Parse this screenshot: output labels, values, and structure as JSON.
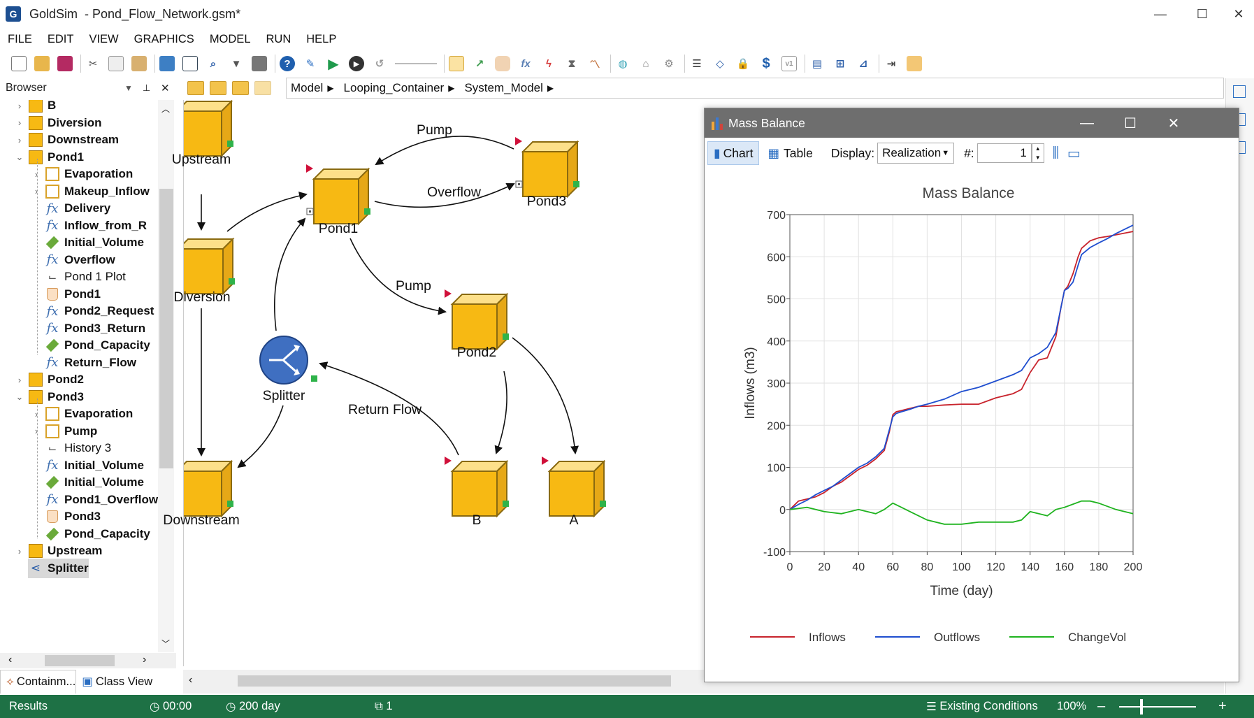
{
  "app": {
    "name": "GoldSim",
    "file": "Pond_Flow_Network.gsm*"
  },
  "window": {
    "min": "—",
    "max": "☐",
    "close": "✕"
  },
  "menu": [
    "FILE",
    "EDIT",
    "VIEW",
    "GRAPHICS",
    "MODEL",
    "RUN",
    "HELP"
  ],
  "browser": {
    "title": "Browser",
    "pin": "📌",
    "close": "✕"
  },
  "breadcrumb": [
    "Model",
    "Looping_Container",
    "System_Model"
  ],
  "tree": [
    {
      "label": "B",
      "icon": "container-icon",
      "bold": true,
      "level": 0,
      "tw": "›"
    },
    {
      "label": "Diversion",
      "icon": "container-icon",
      "bold": true,
      "level": 0,
      "tw": "›"
    },
    {
      "label": "Downstream",
      "icon": "container-icon",
      "bold": true,
      "level": 0,
      "tw": "›"
    },
    {
      "label": "Pond1",
      "icon": "container-icon",
      "bold": true,
      "level": 0,
      "tw": "⌄"
    },
    {
      "label": "Evaporation",
      "icon": "subcontainer-icon",
      "bold": true,
      "level": 1,
      "tw": "›"
    },
    {
      "label": "Makeup_Inflow",
      "icon": "subcontainer-icon",
      "bold": true,
      "level": 1,
      "tw": "›"
    },
    {
      "label": "Delivery",
      "icon": "expression-icon",
      "bold": true,
      "level": 1,
      "tw": ""
    },
    {
      "label": "Inflow_from_R",
      "icon": "expression-icon",
      "bold": true,
      "level": 1,
      "tw": ""
    },
    {
      "label": "Initial_Volume",
      "icon": "data-icon",
      "bold": true,
      "level": 1,
      "tw": ""
    },
    {
      "label": "Overflow",
      "icon": "expression-icon",
      "bold": true,
      "level": 1,
      "tw": ""
    },
    {
      "label": "Pond 1 Plot",
      "icon": "plot-icon",
      "bold": false,
      "level": 1,
      "tw": ""
    },
    {
      "label": "Pond1",
      "icon": "reservoir-icon",
      "bold": true,
      "level": 1,
      "tw": ""
    },
    {
      "label": "Pond2_Request",
      "icon": "expression-icon",
      "bold": true,
      "level": 1,
      "tw": ""
    },
    {
      "label": "Pond3_Return",
      "icon": "expression-icon",
      "bold": true,
      "level": 1,
      "tw": ""
    },
    {
      "label": "Pond_Capacity",
      "icon": "data-icon",
      "bold": true,
      "level": 1,
      "tw": ""
    },
    {
      "label": "Return_Flow",
      "icon": "expression-icon",
      "bold": true,
      "level": 1,
      "tw": ""
    },
    {
      "label": "Pond2",
      "icon": "container-icon",
      "bold": true,
      "level": 0,
      "tw": "›"
    },
    {
      "label": "Pond3",
      "icon": "container-icon",
      "bold": true,
      "level": 0,
      "tw": "⌄"
    },
    {
      "label": "Evaporation",
      "icon": "subcontainer-icon",
      "bold": true,
      "level": 1,
      "tw": "›"
    },
    {
      "label": "Pump",
      "icon": "subcontainer-icon",
      "bold": true,
      "level": 1,
      "tw": "›"
    },
    {
      "label": "History 3",
      "icon": "plot-icon",
      "bold": false,
      "level": 1,
      "tw": ""
    },
    {
      "label": "Initial_Volume",
      "icon": "expression-icon",
      "bold": true,
      "level": 1,
      "tw": ""
    },
    {
      "label": "Initial_Volume",
      "icon": "data-icon",
      "bold": true,
      "level": 1,
      "tw": ""
    },
    {
      "label": "Pond1_Overflow",
      "icon": "expression-icon",
      "bold": true,
      "level": 1,
      "tw": ""
    },
    {
      "label": "Pond3",
      "icon": "reservoir-icon",
      "bold": true,
      "level": 1,
      "tw": ""
    },
    {
      "label": "Pond_Capacity",
      "icon": "data-icon",
      "bold": true,
      "level": 1,
      "tw": ""
    },
    {
      "label": "Upstream",
      "icon": "container-icon",
      "bold": true,
      "level": 0,
      "tw": "›"
    },
    {
      "label": "Splitter",
      "icon": "splitter-icon",
      "bold": true,
      "level": 0,
      "tw": "",
      "selected": true
    }
  ],
  "bottom_tabs": {
    "containment": "Containm...",
    "classview": "Class View"
  },
  "nodes": {
    "upstream": "Upstream",
    "diversion": "Diversion",
    "downstream": "Downstream",
    "pond1": "Pond1",
    "pond2": "Pond2",
    "pond3": "Pond3",
    "b": "B",
    "a": "A",
    "splitter": "Splitter"
  },
  "links": {
    "pump_top": "Pump",
    "overflow": "Overflow",
    "pump_mid": "Pump",
    "return_flow": "Return Flow"
  },
  "mass_balance": {
    "window_title": "Mass Balance",
    "tab_chart": "Chart",
    "tab_table": "Table",
    "display_label": "Display:",
    "display_value": "Realization",
    "num_label": "#:",
    "num_value": "1",
    "colors": {
      "inflows": "#c8232c",
      "outflows": "#1f4ecf",
      "changevol": "#1fb31f"
    }
  },
  "chart_data": {
    "type": "line",
    "title": "Mass Balance",
    "xlabel": "Time (day)",
    "ylabel": "Inflows (m3)",
    "xlim": [
      0,
      200
    ],
    "ylim": [
      -100,
      700
    ],
    "xticks": [
      "0",
      "20",
      "40",
      "60",
      "80",
      "100",
      "120",
      "140",
      "160",
      "180",
      "200"
    ],
    "yticks": [
      "-100",
      "0",
      "100",
      "200",
      "300",
      "400",
      "500",
      "600",
      "700"
    ],
    "grid": true,
    "legend": "bottom",
    "series": [
      {
        "name": "Inflows",
        "x": [
          0,
          5,
          10,
          15,
          20,
          25,
          30,
          35,
          40,
          45,
          50,
          55,
          58,
          60,
          62,
          65,
          70,
          75,
          80,
          90,
          100,
          110,
          120,
          130,
          135,
          140,
          145,
          150,
          155,
          158,
          160,
          162,
          165,
          168,
          170,
          175,
          180,
          185,
          190,
          195,
          200
        ],
        "y": [
          0,
          20,
          25,
          30,
          40,
          55,
          65,
          80,
          95,
          105,
          120,
          140,
          185,
          225,
          232,
          235,
          240,
          245,
          245,
          248,
          250,
          250,
          265,
          275,
          285,
          325,
          355,
          360,
          410,
          480,
          520,
          530,
          560,
          600,
          620,
          638,
          645,
          648,
          652,
          656,
          660
        ]
      },
      {
        "name": "Outflows",
        "x": [
          0,
          5,
          10,
          15,
          20,
          25,
          30,
          35,
          40,
          45,
          50,
          55,
          58,
          60,
          62,
          65,
          70,
          75,
          80,
          90,
          100,
          110,
          120,
          130,
          135,
          140,
          145,
          150,
          155,
          158,
          160,
          162,
          165,
          168,
          170,
          175,
          180,
          185,
          190,
          195,
          200
        ],
        "y": [
          0,
          12,
          22,
          35,
          45,
          55,
          70,
          85,
          100,
          110,
          125,
          145,
          190,
          220,
          228,
          232,
          238,
          245,
          250,
          262,
          280,
          290,
          305,
          320,
          330,
          360,
          370,
          385,
          420,
          480,
          520,
          525,
          540,
          580,
          605,
          622,
          633,
          643,
          655,
          665,
          675
        ]
      },
      {
        "name": "ChangeVol",
        "x": [
          0,
          10,
          20,
          30,
          35,
          40,
          45,
          50,
          55,
          60,
          65,
          70,
          80,
          90,
          100,
          110,
          120,
          130,
          135,
          140,
          145,
          150,
          155,
          160,
          170,
          175,
          180,
          190,
          200
        ],
        "y": [
          0,
          5,
          -5,
          -10,
          -5,
          0,
          -5,
          -10,
          0,
          15,
          5,
          -5,
          -25,
          -35,
          -35,
          -30,
          -30,
          -30,
          -25,
          -5,
          -10,
          -15,
          0,
          5,
          20,
          20,
          15,
          0,
          -10
        ]
      }
    ]
  },
  "status": {
    "results": "Results",
    "elapsed": "00:00",
    "duration": "200 day",
    "realization": "1",
    "scenario": "Existing Conditions",
    "zoom": "100%",
    "zoom_minus": "–",
    "zoom_plus": "+"
  }
}
